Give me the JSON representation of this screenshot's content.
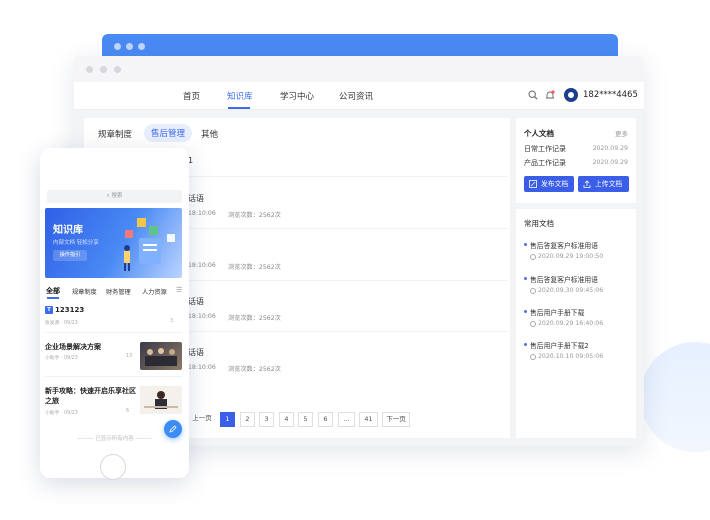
{
  "desktop": {
    "nav": {
      "items": [
        {
          "label": "首页"
        },
        {
          "label": "知识库"
        },
        {
          "label": "学习中心"
        },
        {
          "label": "公司资讯"
        }
      ],
      "active_index": 1,
      "phone": "182****4465"
    },
    "categories": [
      {
        "label": "规章制度"
      },
      {
        "label": "售后管理"
      },
      {
        "label": "其他"
      }
    ],
    "list_rows": [
      {
        "title_partial": "1",
        "meta_time": "",
        "meta_views": ""
      },
      {
        "title_partial": "话语",
        "meta_time": "18:10:06",
        "meta_views": "浏览次数：2562次"
      },
      {
        "title_partial": "",
        "meta_time": "18:10:06",
        "meta_views": "浏览次数：2562次"
      },
      {
        "title_partial": "话语",
        "meta_time": "18:10:06",
        "meta_views": "浏览次数：2562次"
      },
      {
        "title_partial": "话语",
        "meta_time": "18:10:06",
        "meta_views": "浏览次数：2562次"
      }
    ],
    "pagination": {
      "prev": "上一页",
      "pages": [
        "1",
        "2",
        "3",
        "4",
        "5",
        "6",
        "...",
        "41"
      ],
      "next": "下一页",
      "current": "1"
    },
    "personal_docs": {
      "title": "个人文档",
      "more": "更多",
      "items": [
        {
          "name": "日常工作记录",
          "date": "2020.09.29"
        },
        {
          "name": "产品工作记录",
          "date": "2020.09.29"
        }
      ],
      "publish_label": "发布文档",
      "upload_label": "上传文档"
    },
    "common_docs": {
      "title": "常用文档",
      "items": [
        {
          "name": "售后答复客户标准用语",
          "date": "2020.09.29 19:00:50"
        },
        {
          "name": "售后答复客户标准用语",
          "date": "2020.09.30 09:45:06"
        },
        {
          "name": "售后用户手册下载",
          "date": "2020.09.29 16:40:06"
        },
        {
          "name": "售后用户手册下载2",
          "date": "2020.10.10 09:05:06"
        }
      ]
    }
  },
  "mobile": {
    "search_placeholder": "搜索",
    "banner": {
      "title": "知识库",
      "subtitle": "内部文档  轻松分享",
      "button": "操作指引"
    },
    "tabs": [
      {
        "label": "全部"
      },
      {
        "label": "规章制度"
      },
      {
        "label": "财务管理"
      },
      {
        "label": "人力资源"
      }
    ],
    "items": [
      {
        "badge": "T",
        "title": "123123",
        "meta": "张发源 · 09/23",
        "count": "3"
      },
      {
        "title": "企业场景解决方案",
        "meta": "小助手 · 09/23",
        "count": "13"
      },
      {
        "title": "新手攻略：快速开启乐享社区之旅",
        "meta": "小助手 · 09/23",
        "count": "6"
      }
    ],
    "footer": "已显示所有内容"
  },
  "colors": {
    "accent": "#3b6cf0",
    "button": "#3b5ee8",
    "back_window": "#4a8af4"
  }
}
